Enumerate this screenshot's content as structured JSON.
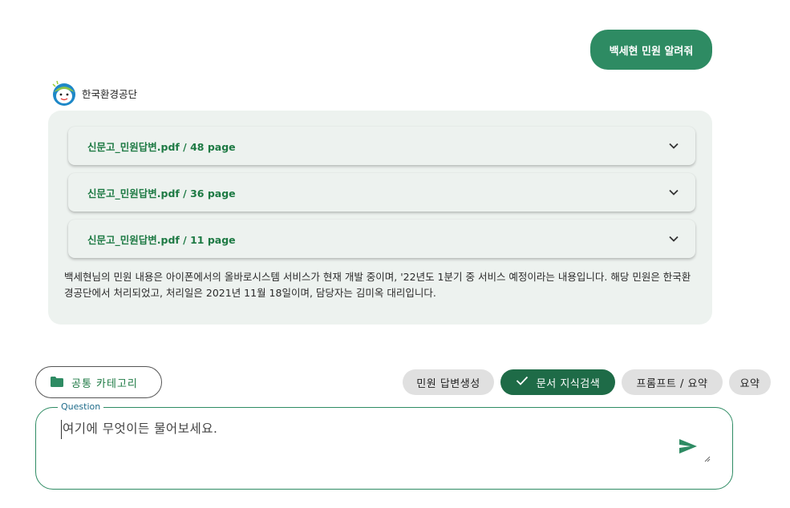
{
  "user_message": {
    "text": "백세현 민원 알려줘"
  },
  "bot": {
    "name": "한국환경공단",
    "avatar_icon": "mascot-avatar-icon"
  },
  "sources": [
    {
      "label": "신문고_민원답변.pdf / 48 page"
    },
    {
      "label": "신문고_민원답변.pdf / 36 page"
    },
    {
      "label": "신문고_민원답변.pdf / 11 page"
    }
  ],
  "answer": {
    "text": "백세현님의 민원 내용은 아이폰에서의 올바로시스템 서비스가 현재 개발 중이며, '22년도 1분기 중 서비스 예정이라는 내용입니다. 해당 민원은 한국환경공단에서 처리되었고, 처리일은 2021년 11월 18일이며, 담당자는 김미옥 대리입니다."
  },
  "category_button": {
    "label": "공통 카테고리",
    "icon": "folder-icon"
  },
  "mode_chips": [
    {
      "label": "민원 답변생성",
      "active": false
    },
    {
      "label": "문서 지식검색",
      "active": true
    },
    {
      "label": "프롬프트 / 요약",
      "active": false
    },
    {
      "label": "요약",
      "active": false
    }
  ],
  "question": {
    "legend": "Question",
    "placeholder": "여기에 무엇이든 물어보세요.",
    "send_icon": "send-icon"
  },
  "colors": {
    "accent": "#2e8b63",
    "accent_dark": "#1e6b47",
    "card_bg": "#edf2ef",
    "chip_bg": "#e0e0e0"
  }
}
